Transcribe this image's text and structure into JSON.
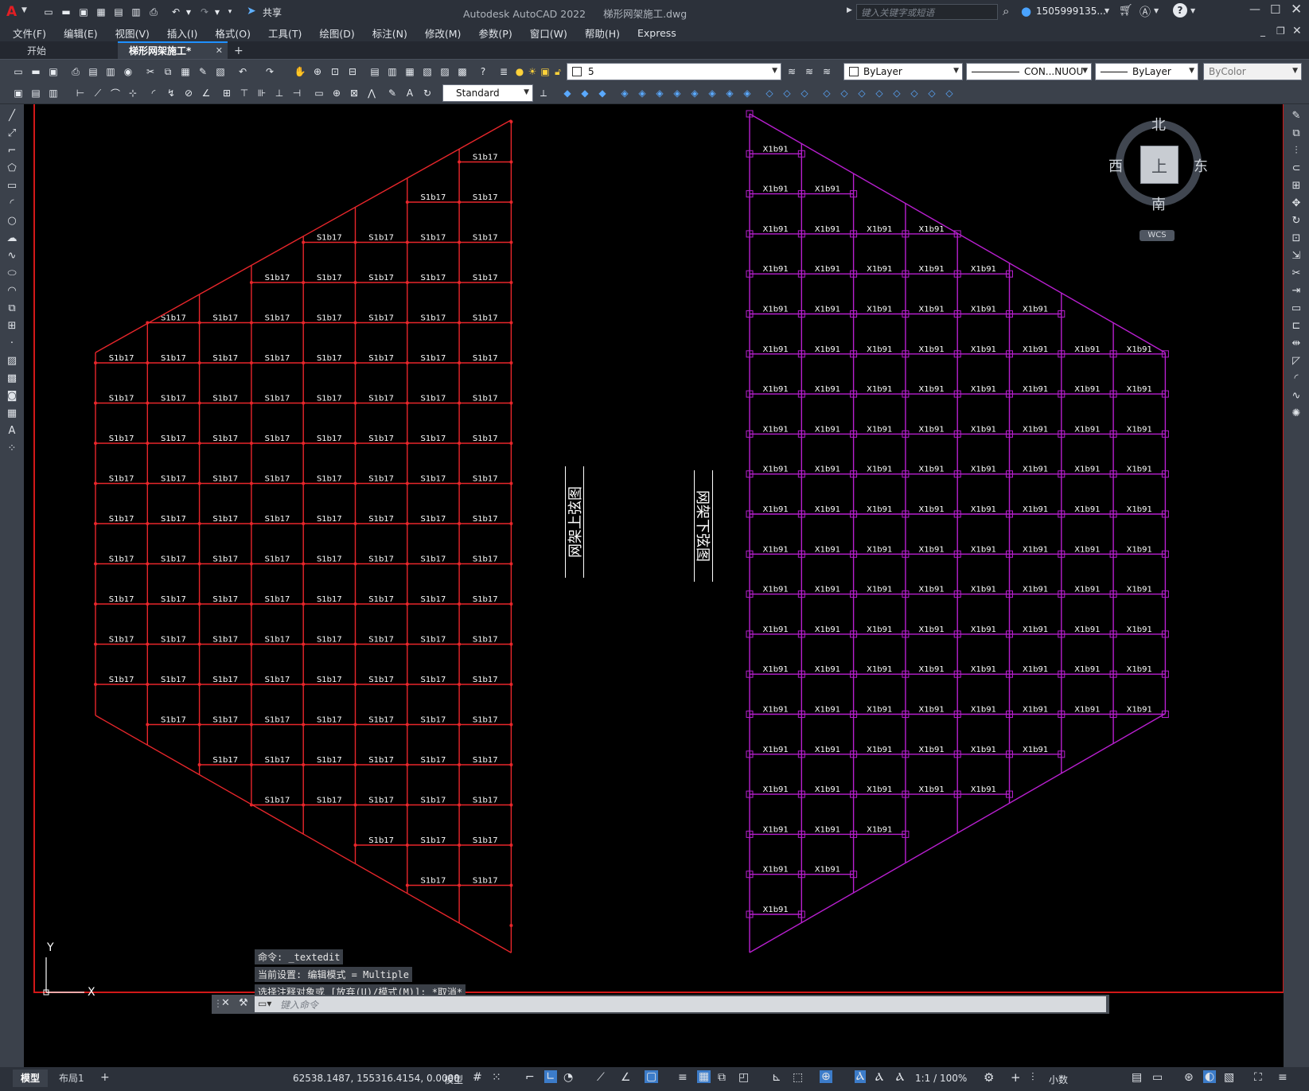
{
  "app": {
    "title": "Autodesk AutoCAD 2022",
    "document": "梯形网架施工.dwg",
    "share_label": "共享",
    "search_placeholder": "键入关键字或短语",
    "user": "1505999135...",
    "logo_letter": "A"
  },
  "menu": [
    "文件(F)",
    "编辑(E)",
    "视图(V)",
    "插入(I)",
    "格式(O)",
    "工具(T)",
    "绘图(D)",
    "标注(N)",
    "修改(M)",
    "参数(P)",
    "窗口(W)",
    "帮助(H)",
    "Express"
  ],
  "doc_tabs": [
    {
      "label": "开始",
      "active": false
    },
    {
      "label": "梯形网架施工*",
      "active": true
    }
  ],
  "toolbar": {
    "layer_value": "5",
    "color_value": "ByLayer",
    "linetype_value": "CON...NUOU",
    "lineweight_value": "ByLayer",
    "plotstyle_value": "ByColor",
    "textstyle_value": "Standard"
  },
  "drawing": {
    "upper_title": "网架上弦图",
    "lower_title": "网架下弦图",
    "upper_color": "#e8262b",
    "lower_color": "#b81fcf",
    "label_color": "#ffffff",
    "upper_grid_label": "S1b17",
    "lower_grid_label": "X1b91",
    "ucs_y": "Y",
    "ucs_x": "X"
  },
  "viewcube": {
    "north": "北",
    "south": "南",
    "east": "东",
    "west": "西",
    "top": "上",
    "wcs": "WCS"
  },
  "command": {
    "history": [
      "命令: _textedit",
      "当前设置: 编辑模式 = Multiple",
      "选择注释对象或 [放弃(U)/模式(M)]: *取消*"
    ],
    "placeholder": "键入命令"
  },
  "layout_tabs": [
    "模型",
    "布局1"
  ],
  "status": {
    "coords": "62538.1487, 155316.4154, 0.0000",
    "space": "模型",
    "scale": "1:1 / 100%",
    "units": "小数"
  }
}
